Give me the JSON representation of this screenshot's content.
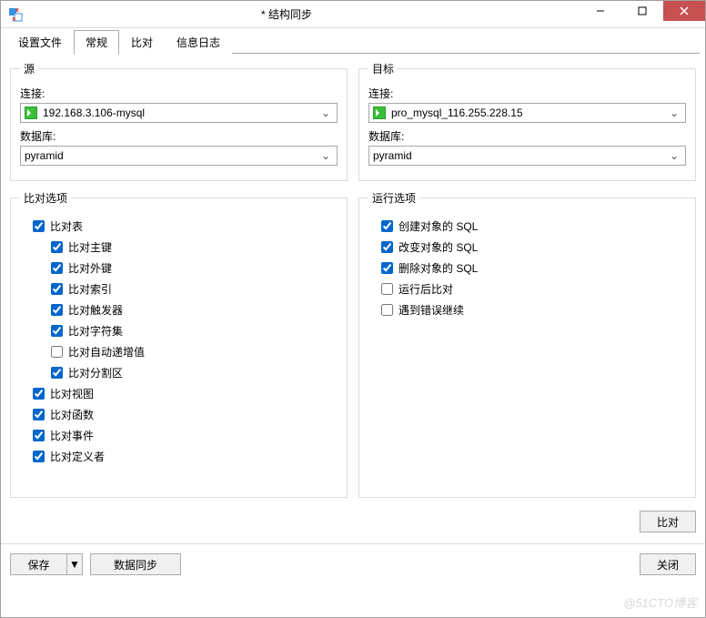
{
  "window": {
    "title": "* 结构同步"
  },
  "tabs": {
    "items": [
      {
        "label": "设置文件",
        "active": false
      },
      {
        "label": "常规",
        "active": true
      },
      {
        "label": "比对",
        "active": false
      },
      {
        "label": "信息日志",
        "active": false
      }
    ]
  },
  "source": {
    "legend": "源",
    "conn_label": "连接:",
    "conn_value": "192.168.3.106-mysql",
    "db_label": "数据库:",
    "db_value": "pyramid"
  },
  "target": {
    "legend": "目标",
    "conn_label": "连接:",
    "conn_value": "pro_mysql_116.255.228.15",
    "db_label": "数据库:",
    "db_value": "pyramid"
  },
  "compare_opts": {
    "legend": "比对选项",
    "items": [
      {
        "label": "比对表",
        "checked": true,
        "indent": 1
      },
      {
        "label": "比对主键",
        "checked": true,
        "indent": 2
      },
      {
        "label": "比对外键",
        "checked": true,
        "indent": 2
      },
      {
        "label": "比对索引",
        "checked": true,
        "indent": 2
      },
      {
        "label": "比对触发器",
        "checked": true,
        "indent": 2
      },
      {
        "label": "比对字符集",
        "checked": true,
        "indent": 2
      },
      {
        "label": "比对自动递增值",
        "checked": false,
        "indent": 2
      },
      {
        "label": "比对分割区",
        "checked": true,
        "indent": 2
      },
      {
        "label": "比对视图",
        "checked": true,
        "indent": 1
      },
      {
        "label": "比对函数",
        "checked": true,
        "indent": 1
      },
      {
        "label": "比对事件",
        "checked": true,
        "indent": 1
      },
      {
        "label": "比对定义者",
        "checked": true,
        "indent": 1
      }
    ]
  },
  "run_opts": {
    "legend": "运行选项",
    "items": [
      {
        "label": "创建对象的 SQL",
        "checked": true
      },
      {
        "label": "改变对象的 SQL",
        "checked": true
      },
      {
        "label": "删除对象的 SQL",
        "checked": true
      },
      {
        "label": "运行后比对",
        "checked": false
      },
      {
        "label": "遇到错误继续",
        "checked": false
      }
    ]
  },
  "buttons": {
    "compare": "比对",
    "save": "保存",
    "datasync": "数据同步",
    "close": "关闭"
  },
  "watermark": "@51CTO博客"
}
